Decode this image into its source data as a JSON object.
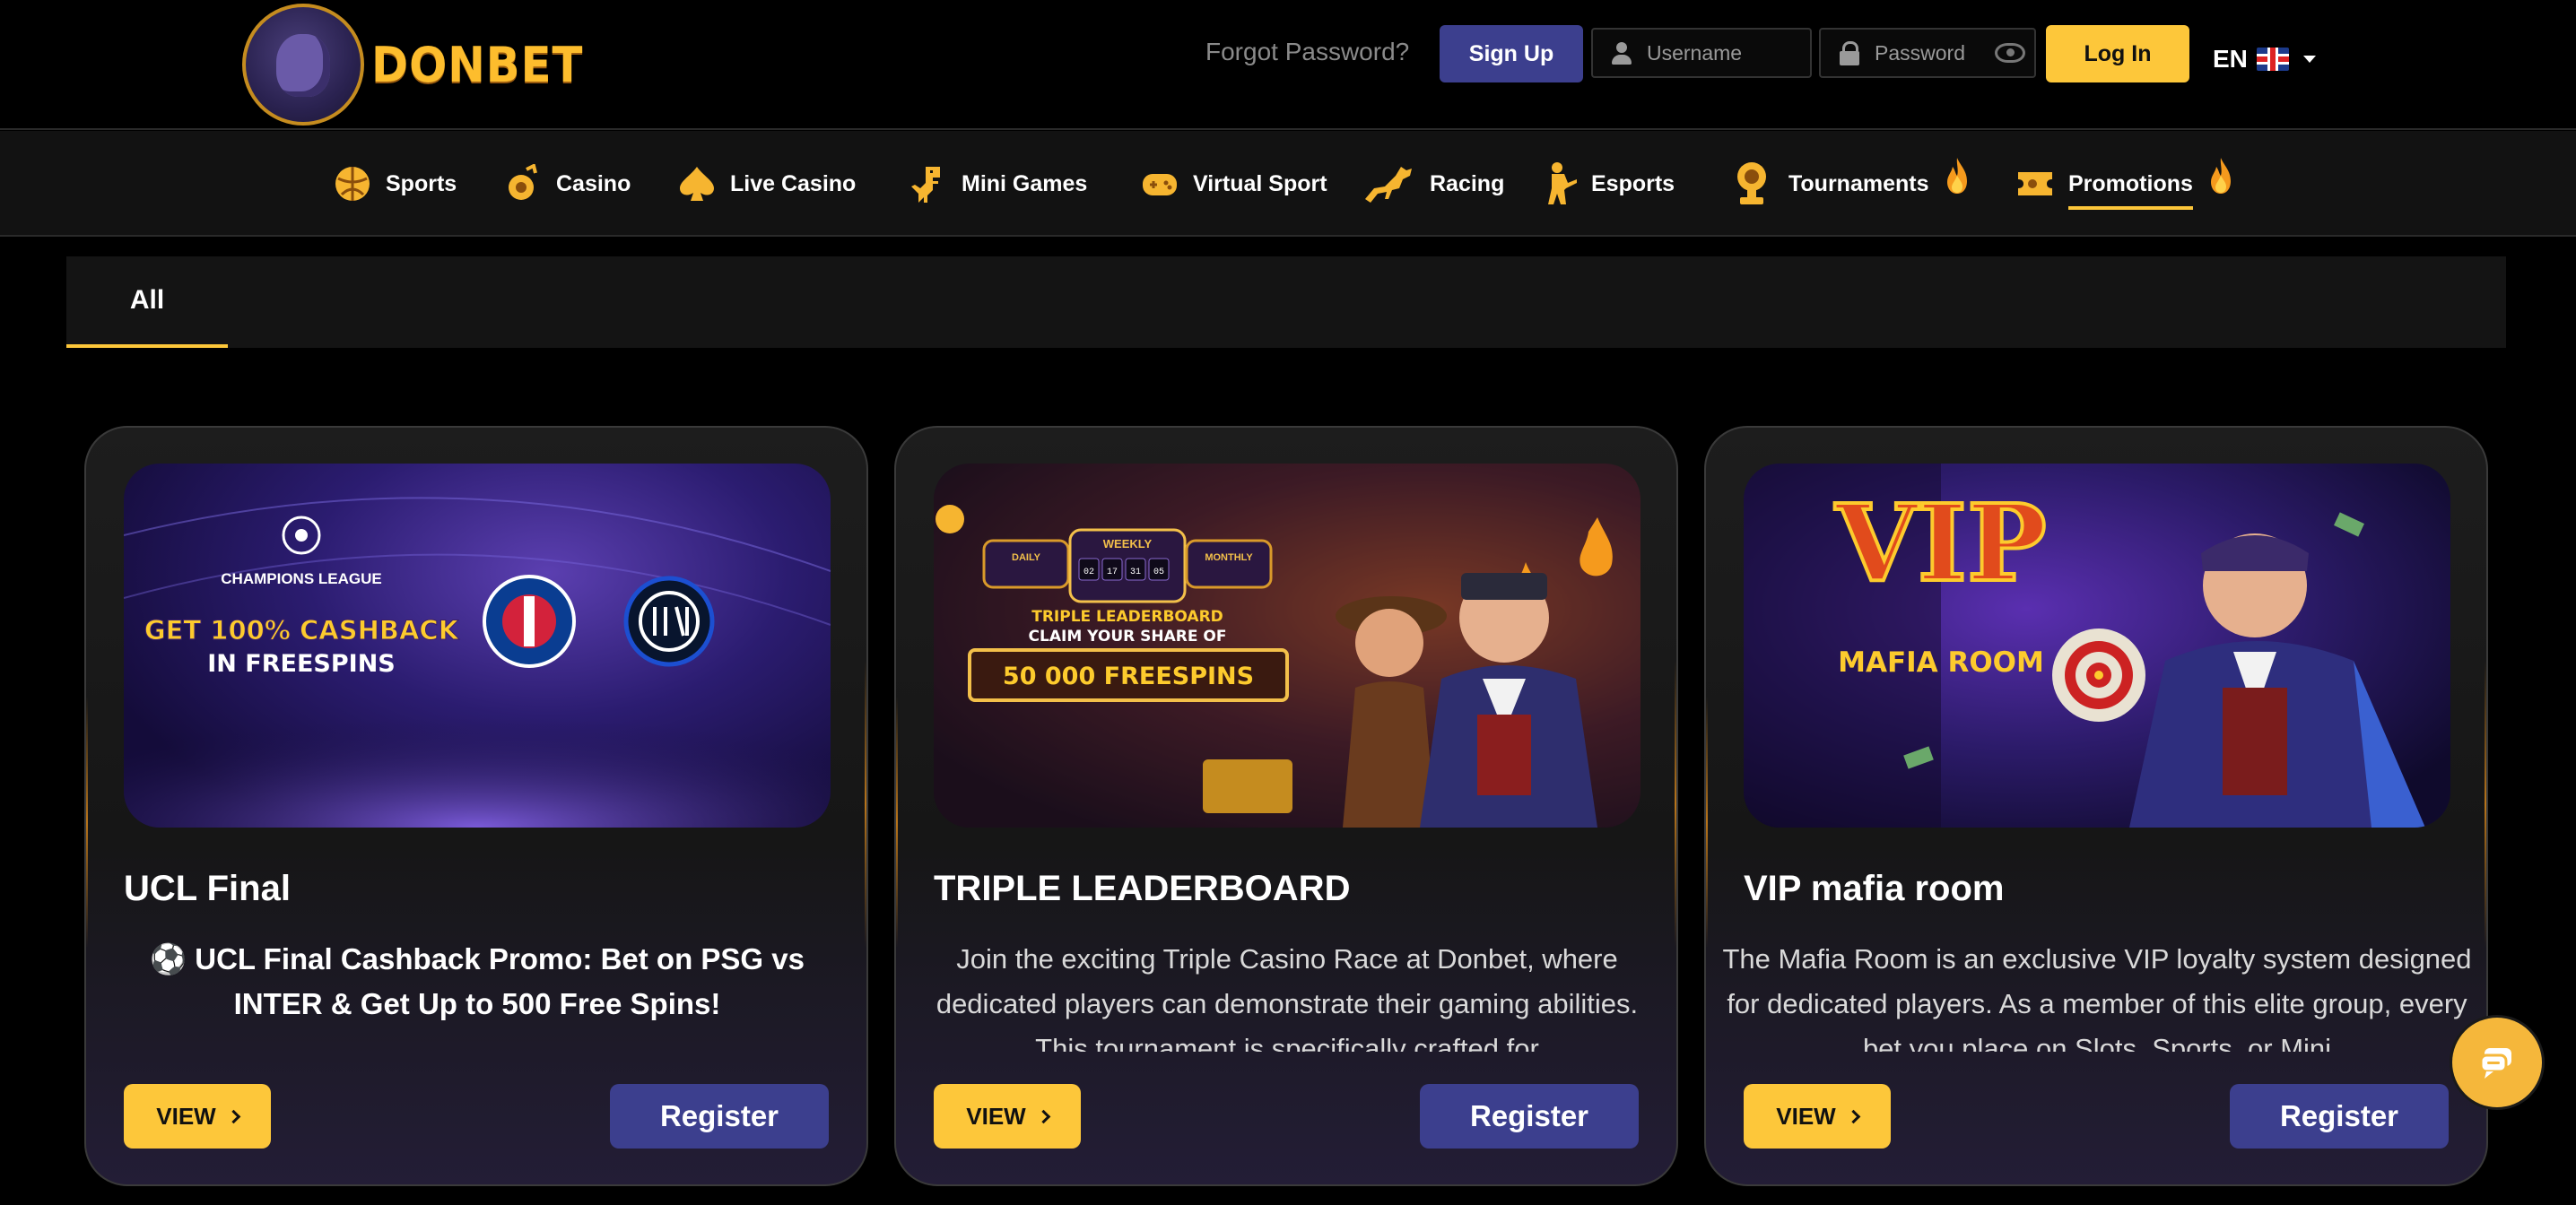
{
  "brand": {
    "name": "DONBET"
  },
  "header": {
    "forgot_password": "Forgot Password?",
    "signup": "Sign Up",
    "username_placeholder": "Username",
    "password_placeholder": "Password",
    "login": "Log In",
    "language": "EN"
  },
  "nav": {
    "items": [
      {
        "label": "Sports",
        "icon": "sports-ball-icon"
      },
      {
        "label": "Casino",
        "icon": "casino-chip-icon"
      },
      {
        "label": "Live Casino",
        "icon": "spade-icon"
      },
      {
        "label": "Mini Games",
        "icon": "dino-icon"
      },
      {
        "label": "Virtual Sport",
        "icon": "gamepad-icon"
      },
      {
        "label": "Racing",
        "icon": "horse-icon"
      },
      {
        "label": "Esports",
        "icon": "soldier-icon"
      },
      {
        "label": "Tournaments",
        "icon": "trophy-icon",
        "hot": true
      },
      {
        "label": "Promotions",
        "icon": "ticket-icon",
        "hot": true,
        "active": true
      }
    ]
  },
  "tabs": {
    "all": "All"
  },
  "cards": [
    {
      "title": "UCL Final",
      "description": "⚽ UCL Final Cashback Promo: Bet on PSG vs INTER & Get Up to 500 Free Spins!",
      "banner": {
        "league": "CHAMPIONS LEAGUE",
        "line1": "GET 100% CASHBACK",
        "line2": "IN FREESPINS"
      },
      "view": "VIEW",
      "register": "Register"
    },
    {
      "title": "TRIPLE LEADERBOARD",
      "description": "Join the exciting Triple Casino Race at Donbet, where dedicated players can demonstrate their gaming abilities. This tournament is specifically crafted for",
      "banner": {
        "daily": "DAILY",
        "weekly": "WEEKLY",
        "monthly": "MONTHLY",
        "timer": [
          "02",
          "17",
          "31",
          "05"
        ],
        "line1": "TRIPLE LEADERBOARD",
        "line2": "CLAIM YOUR SHARE OF",
        "prize": "50 000 FREESPINS"
      },
      "view": "VIEW",
      "register": "Register"
    },
    {
      "title": "VIP mafia room",
      "description": "The Mafia Room is an exclusive VIP loyalty system designed for dedicated players. As a member of this elite group, every bet you place on Slots, Sports, or Mini",
      "banner": {
        "big": "VIP",
        "small": "MAFIA ROOM"
      },
      "view": "VIEW",
      "register": "Register"
    }
  ],
  "colors": {
    "accent": "#fdc73a",
    "primary": "#3c3f8e",
    "background": "#000000"
  }
}
